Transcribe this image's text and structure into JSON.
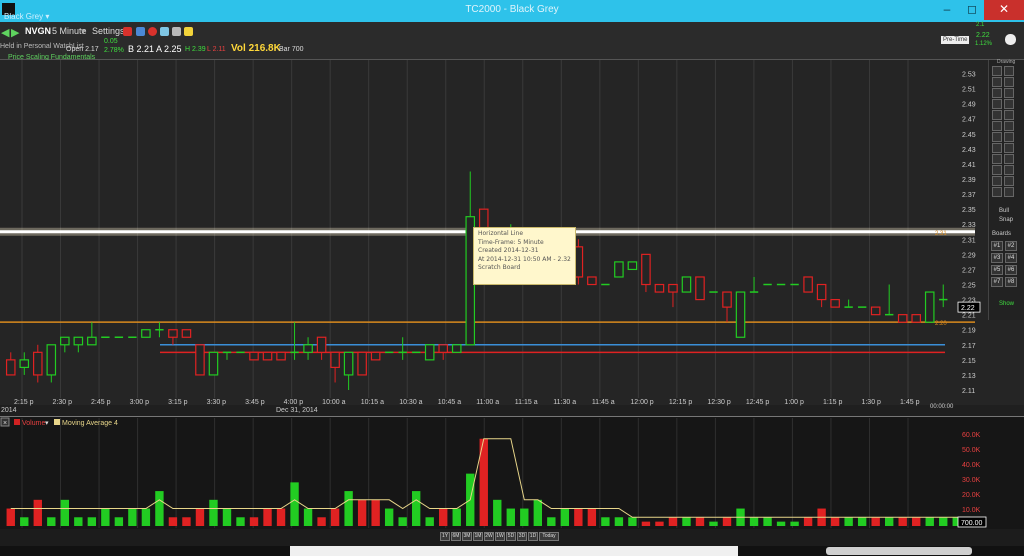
{
  "window": {
    "title": "TC2000 - Black Grey",
    "layout_menu": "Black Grey ▾"
  },
  "toolbar": {
    "symbol": "NVGN",
    "interval": "5 Minute",
    "settings": "Settings",
    "watchlist": "Held in Personal WatchList",
    "open_label": "Open 2.17",
    "change_amt": "0.05",
    "change_pct": "2.78%",
    "bid": "B 2.21",
    "ask": "A 2.25",
    "high": "H 2.39",
    "low": "L 2.11",
    "volume": "Vol 216.8K",
    "bar": "Bar 700",
    "indicator": "Price Scaling Fundamentals",
    "right_btn": "Pre-Time",
    "right_price": "2.22",
    "right_change": "1.12%",
    "right_num": "2.1"
  },
  "tooltip": {
    "lines": [
      "Horizontal Line",
      "Time-Frame: 5 Minute",
      "Created 2014-12-31",
      "At 2014-12-31 10:50 AM - 2.32",
      "Scratch Board"
    ]
  },
  "price_axis": {
    "labels": [
      "2.53",
      "2.51",
      "2.49",
      "2.47",
      "2.45",
      "2.43",
      "2.41",
      "2.39",
      "2.37",
      "2.35",
      "2.33",
      "2.31",
      "2.29",
      "2.27",
      "2.25",
      "2.23",
      "2.21",
      "2.19",
      "2.17",
      "2.15",
      "2.13",
      "2.11"
    ],
    "current_price": "2.22",
    "line_tag_upper": "2.31",
    "line_tag_lower": "2.20"
  },
  "time_axis": {
    "labels": [
      "2:15 p",
      "2:30 p",
      "2:45 p",
      "3:00 p",
      "3:15 p",
      "3:30 p",
      "3:45 p",
      "4:00 p",
      "10:00 a",
      "10:15 a",
      "10:30 a",
      "10:45 a",
      "11:00 a",
      "11:15 a",
      "11:30 a",
      "11:45 a",
      "12:00 p",
      "12:15 p",
      "12:30 p",
      "12:45 p",
      "1:00 p",
      "1:15 p",
      "1:30 p",
      "1:45 p"
    ],
    "year_label": "2014",
    "date_label": "Dec 31, 2014",
    "clock": "00:00:00"
  },
  "volume_panel": {
    "title": "Volume",
    "ma_title": "Moving Average 4",
    "axis_labels": [
      "60.0K",
      "50.0K",
      "40.0K",
      "30.0K",
      "20.0K",
      "10.0K"
    ],
    "current": "700.00"
  },
  "right_panel": {
    "header": "Drawing",
    "row_labels": [
      "Bull",
      "Snap",
      "Boards",
      "Show"
    ],
    "board_buttons": [
      "#1",
      "#2",
      "#3",
      "#4",
      "#5",
      "#6",
      "#7",
      "#8"
    ]
  },
  "timeframe_buttons": [
    "1Y",
    "6M",
    "3M",
    "1M",
    "2W",
    "1W",
    "5D",
    "3D",
    "1D",
    "Today"
  ],
  "chart_data": {
    "type": "candlestick",
    "series": [
      {
        "name": "price",
        "ohlc": [
          [
            2.15,
            2.16,
            2.13,
            2.13
          ],
          [
            2.14,
            2.16,
            2.13,
            2.15
          ],
          [
            2.16,
            2.17,
            2.12,
            2.13
          ],
          [
            2.13,
            2.17,
            2.12,
            2.17
          ],
          [
            2.17,
            2.18,
            2.16,
            2.18
          ],
          [
            2.17,
            2.18,
            2.16,
            2.18
          ],
          [
            2.17,
            2.2,
            2.17,
            2.18
          ],
          [
            2.18,
            2.18,
            2.18,
            2.18
          ],
          [
            2.18,
            2.18,
            2.18,
            2.18
          ],
          [
            2.18,
            2.18,
            2.18,
            2.18
          ],
          [
            2.18,
            2.19,
            2.18,
            2.19
          ],
          [
            2.19,
            2.2,
            2.18,
            2.19
          ],
          [
            2.19,
            2.19,
            2.17,
            2.18
          ],
          [
            2.19,
            2.19,
            2.18,
            2.18
          ],
          [
            2.17,
            2.17,
            2.13,
            2.13
          ],
          [
            2.13,
            2.16,
            2.13,
            2.16
          ],
          [
            2.16,
            2.16,
            2.15,
            2.16
          ],
          [
            2.16,
            2.16,
            2.16,
            2.16
          ],
          [
            2.16,
            2.16,
            2.15,
            2.15
          ],
          [
            2.16,
            2.16,
            2.15,
            2.15
          ],
          [
            2.16,
            2.16,
            2.15,
            2.15
          ],
          [
            2.16,
            2.2,
            2.15,
            2.16
          ],
          [
            2.16,
            2.18,
            2.15,
            2.17
          ],
          [
            2.18,
            2.18,
            2.15,
            2.16
          ],
          [
            2.16,
            2.16,
            2.12,
            2.14
          ],
          [
            2.13,
            2.15,
            2.11,
            2.16
          ],
          [
            2.16,
            2.16,
            2.13,
            2.13
          ],
          [
            2.16,
            2.16,
            2.15,
            2.15
          ],
          [
            2.16,
            2.16,
            2.16,
            2.16
          ],
          [
            2.16,
            2.18,
            2.15,
            2.16
          ],
          [
            2.16,
            2.16,
            2.16,
            2.16
          ],
          [
            2.15,
            2.17,
            2.15,
            2.17
          ],
          [
            2.17,
            2.17,
            2.15,
            2.16
          ],
          [
            2.16,
            2.16,
            2.16,
            2.17
          ],
          [
            2.17,
            2.4,
            2.17,
            2.34
          ],
          [
            2.35,
            2.35,
            2.31,
            2.31
          ],
          [
            2.32,
            2.32,
            2.32,
            2.32
          ],
          [
            2.32,
            2.33,
            2.32,
            2.32
          ],
          [
            2.32,
            2.32,
            2.32,
            2.32
          ],
          [
            2.32,
            2.32,
            2.32,
            2.32
          ],
          [
            2.31,
            2.31,
            2.31,
            2.31
          ],
          [
            2.31,
            2.32,
            2.31,
            2.31
          ],
          [
            2.3,
            2.31,
            2.25,
            2.26
          ],
          [
            2.26,
            2.26,
            2.25,
            2.25
          ],
          [
            2.25,
            2.25,
            2.25,
            2.25
          ],
          [
            2.26,
            2.28,
            2.26,
            2.28
          ],
          [
            2.27,
            2.28,
            2.27,
            2.28
          ],
          [
            2.29,
            2.29,
            2.24,
            2.25
          ],
          [
            2.25,
            2.25,
            2.24,
            2.24
          ],
          [
            2.25,
            2.25,
            2.22,
            2.24
          ],
          [
            2.24,
            2.26,
            2.24,
            2.26
          ],
          [
            2.26,
            2.26,
            2.23,
            2.23
          ],
          [
            2.24,
            2.24,
            2.24,
            2.24
          ],
          [
            2.24,
            2.24,
            2.2,
            2.22
          ],
          [
            2.18,
            2.22,
            2.18,
            2.24
          ],
          [
            2.24,
            2.26,
            2.24,
            2.24
          ],
          [
            2.25,
            2.25,
            2.25,
            2.25
          ],
          [
            2.25,
            2.25,
            2.25,
            2.25
          ],
          [
            2.25,
            2.25,
            2.25,
            2.25
          ],
          [
            2.26,
            2.26,
            2.24,
            2.24
          ],
          [
            2.25,
            2.25,
            2.22,
            2.23
          ],
          [
            2.23,
            2.23,
            2.22,
            2.22
          ],
          [
            2.22,
            2.23,
            2.22,
            2.22
          ],
          [
            2.22,
            2.22,
            2.22,
            2.22
          ],
          [
            2.22,
            2.22,
            2.21,
            2.21
          ],
          [
            2.21,
            2.25,
            2.21,
            2.21
          ],
          [
            2.21,
            2.21,
            2.2,
            2.2
          ],
          [
            2.21,
            2.21,
            2.2,
            2.2
          ],
          [
            2.2,
            2.24,
            2.2,
            2.24
          ],
          [
            2.23,
            2.25,
            2.22,
            2.23
          ]
        ]
      },
      {
        "name": "volume",
        "values": [
          2,
          1,
          3,
          1,
          3,
          1,
          1,
          2,
          1,
          2,
          2,
          4,
          1,
          1,
          2,
          3,
          2,
          1,
          1,
          2,
          2,
          5,
          2,
          1,
          2,
          4,
          3,
          3,
          2,
          1,
          4,
          1,
          2,
          2,
          6,
          10,
          3,
          2,
          2,
          3,
          1,
          2,
          2,
          2,
          1,
          1,
          1,
          0.5,
          0.5,
          1,
          1,
          1,
          0.5,
          1,
          2,
          1,
          1,
          0.5,
          0.5,
          1,
          2,
          1,
          1,
          1,
          1,
          1,
          1,
          1,
          1,
          1,
          1,
          1
        ]
      },
      {
        "name": "Moving Average 4",
        "values": [
          2,
          2,
          2,
          2,
          2,
          2,
          2,
          2,
          2,
          2,
          2,
          3,
          2,
          2,
          2,
          2,
          2,
          2,
          2,
          2,
          2,
          3,
          2,
          2,
          2,
          3,
          3,
          3,
          3,
          2,
          3,
          2,
          2,
          2,
          3,
          10,
          10,
          10,
          3,
          3,
          2,
          2,
          2,
          2,
          2,
          2,
          1,
          1,
          1,
          1,
          1,
          1,
          1,
          1,
          1,
          1,
          1,
          1,
          1,
          1,
          1,
          1,
          1,
          1,
          1,
          1,
          1,
          1,
          1,
          1,
          1,
          1
        ]
      }
    ],
    "ylim": [
      2.11,
      2.54
    ],
    "horizontal_lines": [
      2.32,
      2.2,
      2.17,
      2.16
    ],
    "colors": {
      "up": "#22cc22",
      "down": "#e02222",
      "hline_white": "#ffffff",
      "hline_orange": "#d98a1e",
      "hline_blue": "#3a8fd8",
      "hline_red": "#e02222",
      "ma": "#e8d68a"
    }
  }
}
